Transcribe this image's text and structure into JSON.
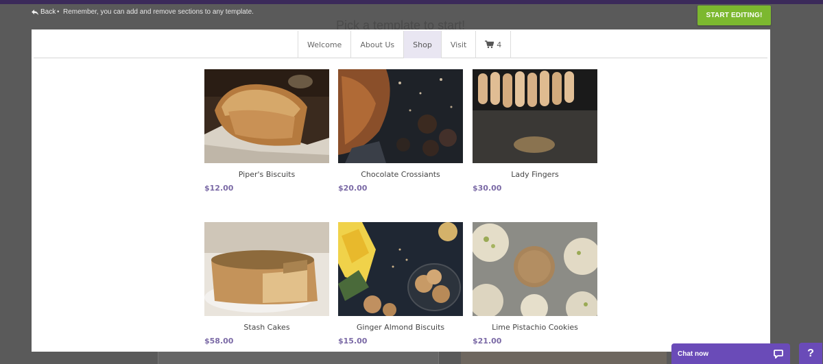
{
  "topbar": {
    "back_label": "Back",
    "separator": "•",
    "hint": "Remember, you can add and remove sections to any template.",
    "start_button": "START EDITING!"
  },
  "background": {
    "heading": "Pick a template to start!"
  },
  "nav": {
    "items": [
      {
        "label": "Welcome",
        "active": false
      },
      {
        "label": "About Us",
        "active": false
      },
      {
        "label": "Shop",
        "active": true
      },
      {
        "label": "Visit",
        "active": false
      }
    ],
    "cart_count": "4",
    "cart_icon": "shopping-cart-icon"
  },
  "products": [
    {
      "name": "Piper's Biscuits",
      "price": "$12.00",
      "image": "bread-loaf-photo"
    },
    {
      "name": "Chocolate Crossiants",
      "price": "$20.00",
      "image": "chocolate-croissant-photo"
    },
    {
      "name": "Lady Fingers",
      "price": "$30.00",
      "image": "lady-fingers-photo"
    },
    {
      "name": "Stash Cakes",
      "price": "$58.00",
      "image": "cake-slice-photo"
    },
    {
      "name": "Ginger Almond Biscuits",
      "price": "$15.00",
      "image": "almond-biscuits-photo"
    },
    {
      "name": "Lime Pistachio Cookies",
      "price": "$21.00",
      "image": "pistachio-cookies-photo"
    }
  ],
  "chat": {
    "label": "Chat now",
    "icon": "chat-bubble-icon"
  },
  "help": {
    "label": "?"
  },
  "colors": {
    "accent_green": "#7cb82f",
    "price_purple": "#7b6aa6",
    "chat_purple": "#6a4bb8",
    "active_tab": "#e9e6f2"
  }
}
